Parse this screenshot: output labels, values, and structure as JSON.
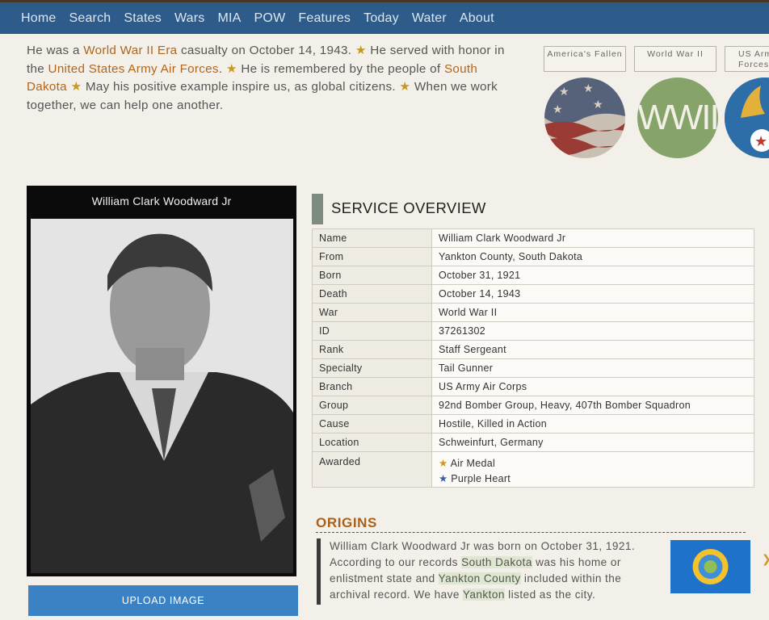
{
  "nav": {
    "items": [
      "Home",
      "Search",
      "States",
      "Wars",
      "MIA",
      "POW",
      "Features",
      "Today",
      "Water",
      "About"
    ]
  },
  "intro": {
    "p1": "He was a ",
    "war_link": "World War II Era",
    "p2": " casualty on October 14, 1943. ",
    "p3": " He served with honor in the ",
    "branch_link": "United States Army Air Forces",
    "p4": ". ",
    "p5": " He is remembered by the people of ",
    "state_link": "South Dakota",
    "p6": " ",
    "p7": " May his positive example inspire us, as global citizens. ",
    "p8": " When we work together, we can help one another.",
    "star": "★"
  },
  "categories": [
    {
      "label": "America's Fallen",
      "icon": "flag-circle-icon"
    },
    {
      "label": "World War II",
      "icon": "wwii-circle-icon",
      "badge_text": "WWII"
    },
    {
      "label": "US Army Air Forces",
      "icon": "army-air-forces-circle-icon"
    }
  ],
  "photo": {
    "name": "William Clark Woodward Jr"
  },
  "upload_label": "UPLOAD IMAGE",
  "service": {
    "title": "SERVICE OVERVIEW",
    "rows": [
      {
        "k": "Name",
        "v": "William Clark Woodward Jr"
      },
      {
        "k": "From",
        "v": "Yankton County, South Dakota"
      },
      {
        "k": "Born",
        "v": "October 31, 1921"
      },
      {
        "k": "Death",
        "v": "October 14, 1943"
      },
      {
        "k": "War",
        "v": "World War II"
      },
      {
        "k": "ID",
        "v": "37261302"
      },
      {
        "k": "Rank",
        "v": "Staff Sergeant"
      },
      {
        "k": "Specialty",
        "v": "Tail Gunner"
      },
      {
        "k": "Branch",
        "v": "US Army Air Corps"
      },
      {
        "k": "Group",
        "v": "92nd Bomber Group, Heavy, 407th Bomber Squadron"
      },
      {
        "k": "Cause",
        "v": "Hostile, Killed in Action"
      },
      {
        "k": "Location",
        "v": "Schweinfurt, Germany"
      }
    ],
    "awarded_label": "Awarded",
    "awards": [
      {
        "name": "Air Medal",
        "star_color": "#c99a1e"
      },
      {
        "name": "Purple Heart",
        "star_color": "#3b5c9b"
      }
    ]
  },
  "origins": {
    "title": "ORIGINS",
    "t1": "William Clark Woodward Jr was born on October 31, 1921. According to our records ",
    "state": "South Dakota",
    "t2": " was his home or enlistment state and ",
    "county": "Yankton County",
    "t3": " included within the archival record. We have ",
    "city": "Yankton",
    "t4": " listed as the city."
  },
  "colors": {
    "nav_bg": "#2d5b8a",
    "link": "#b0651c",
    "star_gold": "#c99a1e",
    "button": "#3b82c4"
  }
}
